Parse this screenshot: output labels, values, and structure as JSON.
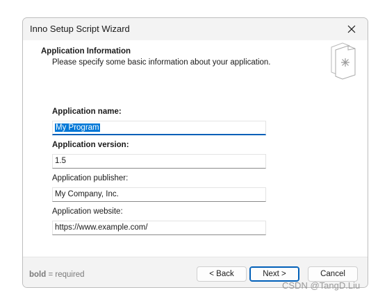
{
  "window": {
    "title": "Inno Setup Script Wizard",
    "close_icon": "close-icon"
  },
  "header": {
    "title": "Application Information",
    "subtitle": "Please specify some basic information about your application.",
    "icon": "setup-wizard-document-icon"
  },
  "form": {
    "app_name": {
      "label": "Application name:",
      "value": "My Program",
      "required": true,
      "focused": true,
      "selected": true
    },
    "app_version": {
      "label": "Application version:",
      "value": "1.5",
      "required": true
    },
    "app_publisher": {
      "label": "Application publisher:",
      "value": "My Company, Inc.",
      "required": false
    },
    "app_website": {
      "label": "Application website:",
      "value": "https://www.example.com/",
      "required": false
    }
  },
  "footer": {
    "required_note_bold": "bold",
    "required_note_rest": " = required",
    "back_label": "< Back",
    "next_label": "Next >",
    "cancel_label": "Cancel"
  },
  "watermark": "CSDN @TangD.Liu",
  "colors": {
    "accent": "#005fb8",
    "selection": "#0078d7",
    "dialog_bg": "#f3f3f3"
  }
}
